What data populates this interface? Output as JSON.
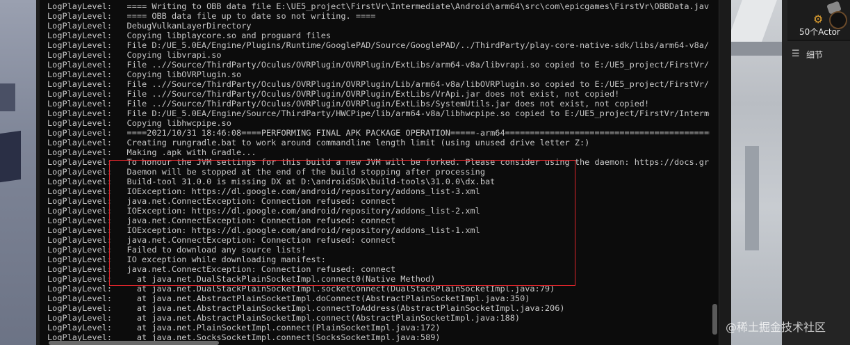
{
  "console": {
    "lines": [
      "LogPlayLevel:   ==== Writing to OBB data file E:\\UE5_project\\FirstVr\\Intermediate\\Android\\arm64\\src\\com\\epicgames\\FirstVr\\OBBData.java ==",
      "LogPlayLevel:   ==== OBB data file up to date so not writing. ====",
      "LogPlayLevel:   DebugVulkanLayerDirectory",
      "LogPlayLevel:   Copying libplaycore.so and proguard files",
      "LogPlayLevel:   File D:/UE_5.0EA/Engine/Plugins/Runtime/GooglePAD/Source/GooglePAD/../ThirdParty/play-core-native-sdk/libs/arm64-v8a/ndk2",
      "LogPlayLevel:   Copying libvrapi.so",
      "LogPlayLevel:   File ..//Source/ThirdParty/Oculus/OVRPlugin/OVRPlugin/ExtLibs/arm64-v8a/libvrapi.so copied to E:/UE5_project/FirstVr/Inte",
      "LogPlayLevel:   Copying libOVRPlugin.so",
      "LogPlayLevel:   File ..//Source/ThirdParty/Oculus/OVRPlugin/OVRPlugin/Lib/arm64-v8a/libOVRPlugin.so copied to E:/UE5_project/FirstVr/Inte",
      "LogPlayLevel:   File ..//Source/ThirdParty/Oculus/OVRPlugin/OVRPlugin/ExtLibs/VrApi.jar does not exist, not copied!",
      "LogPlayLevel:   File ..//Source/ThirdParty/Oculus/OVRPlugin/OVRPlugin/ExtLibs/SystemUtils.jar does not exist, not copied!",
      "LogPlayLevel:   File D:/UE_5.0EA/Engine/Source/ThirdParty/HWCPipe/lib/arm64-v8a/libhwcpipe.so copied to E:/UE5_project/FirstVr/Intermedia",
      "LogPlayLevel:   Copying libhwcpipe.so",
      "LogPlayLevel:   ====2021/10/31 18:46:08====PERFORMING FINAL APK PACKAGE OPERATION=====-arm64===========================================",
      "LogPlayLevel:   Creating rungradle.bat to work around commandline length limit (using unused drive letter Z:)",
      "LogPlayLevel:   Making .apk with Gradle...",
      "LogPlayLevel:   To honour the JVM settings for this build a new JVM will be forked. Please consider using the daemon: https://docs.gradle",
      "LogPlayLevel:   Daemon will be stopped at the end of the build stopping after processing",
      "LogPlayLevel:   Build-tool 31.0.0 is missing DX at D:\\androidSDk\\build-tools\\31.0.0\\dx.bat",
      "LogPlayLevel:   IOException: https://dl.google.com/android/repository/addons_list-3.xml",
      "LogPlayLevel:   java.net.ConnectException: Connection refused: connect",
      "LogPlayLevel:   IOException: https://dl.google.com/android/repository/addons_list-2.xml",
      "LogPlayLevel:   java.net.ConnectException: Connection refused: connect",
      "LogPlayLevel:   IOException: https://dl.google.com/android/repository/addons_list-1.xml",
      "LogPlayLevel:   java.net.ConnectException: Connection refused: connect",
      "LogPlayLevel:   Failed to download any source lists!",
      "LogPlayLevel:   IO exception while downloading manifest:",
      "LogPlayLevel:   java.net.ConnectException: Connection refused: connect",
      "LogPlayLevel:     at java.net.DualStackPlainSocketImpl.connect0(Native Method)",
      "LogPlayLevel:     at java.net.DualStackPlainSocketImpl.socketConnect(DualStackPlainSocketImpl.java:79)",
      "LogPlayLevel:     at java.net.AbstractPlainSocketImpl.doConnect(AbstractPlainSocketImpl.java:350)",
      "LogPlayLevel:     at java.net.AbstractPlainSocketImpl.connectToAddress(AbstractPlainSocketImpl.java:206)",
      "LogPlayLevel:     at java.net.AbstractPlainSocketImpl.connect(AbstractPlainSocketImpl.java:188)",
      "LogPlayLevel:     at java.net.PlainSocketImpl.connect(PlainSocketImpl.java:172)",
      "LogPlayLevel:     at java.net.SocksSocketImpl.connect(SocksSocketImpl.java:589)"
    ],
    "highlight_color": "#e0252b",
    "text_color": "#c8c8c8",
    "background": "#0c0c0c"
  },
  "right_panel": {
    "actor_count": "50个Actor",
    "details_tab_label": "细节",
    "icons": [
      "gear-icon",
      "actor-icon",
      "details-icon"
    ]
  },
  "watermark": "@稀土掘金技术社区"
}
